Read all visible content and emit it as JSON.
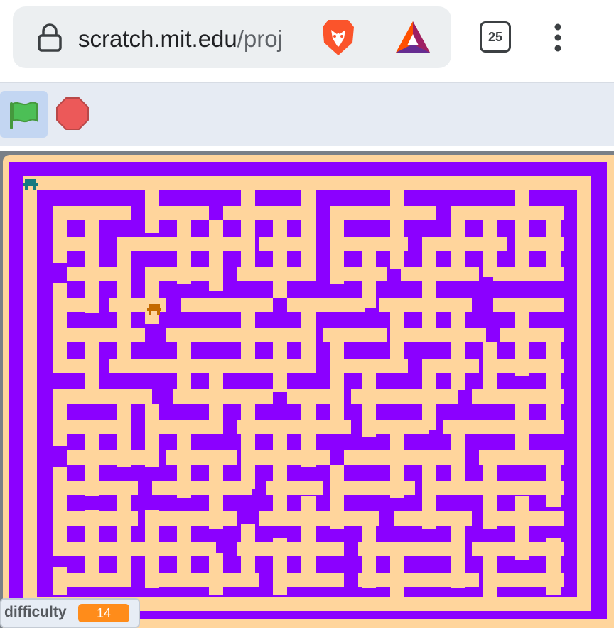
{
  "browser": {
    "url_host": "scratch.mit.edu",
    "url_path": "/proj",
    "tab_count": "25",
    "icons": [
      "lock-icon",
      "brave-lion-icon",
      "bat-rewards-icon",
      "tab-switcher-icon",
      "overflow-menu-icon"
    ]
  },
  "toolbar": {
    "green_flag_icon": "green-flag-icon",
    "stop_icon": "stop-sign-icon"
  },
  "colors": {
    "wall": "#8b00ff",
    "path": "#ffd59c",
    "player": "#167a80",
    "goal": "#c46a00",
    "monitor_value_bg": "#ff8c1a"
  },
  "game": {
    "sprites": [
      {
        "name": "player-sprite",
        "color": "teal"
      },
      {
        "name": "goal-sprite",
        "color": "orange"
      }
    ]
  },
  "monitor": {
    "label": "difficulty",
    "value": "14"
  }
}
